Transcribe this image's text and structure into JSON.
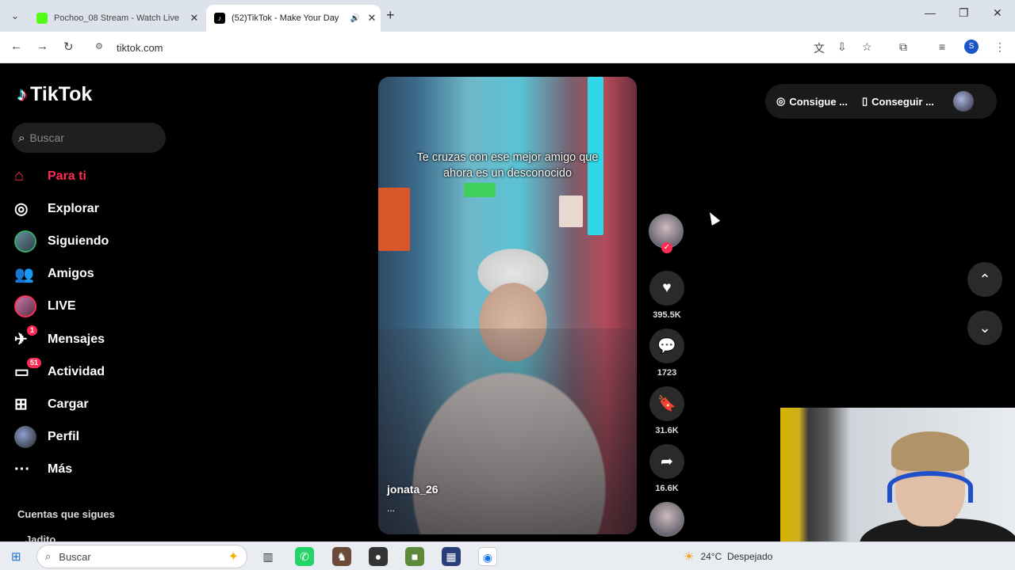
{
  "browser": {
    "tabs": [
      {
        "title": "Pochoo_08 Stream - Watch Live",
        "favicon_color": "#53fc18",
        "active": false
      },
      {
        "title": "(52)TikTok - Make Your Day",
        "favicon_color": "#000000",
        "active": true
      }
    ],
    "url": "tiktok.com",
    "profile_initial": "S"
  },
  "sidebar": {
    "logo": "TikTok",
    "search_placeholder": "Buscar",
    "items": [
      {
        "label": "Para ti",
        "icon": "home-icon",
        "active": true
      },
      {
        "label": "Explorar",
        "icon": "compass-icon"
      },
      {
        "label": "Siguiendo",
        "icon": "following-avatar-icon"
      },
      {
        "label": "Amigos",
        "icon": "friends-icon"
      },
      {
        "label": "LIVE",
        "icon": "live-avatar-icon"
      },
      {
        "label": "Mensajes",
        "icon": "messages-icon",
        "badge": "1"
      },
      {
        "label": "Actividad",
        "icon": "activity-icon",
        "badge": "51"
      },
      {
        "label": "Cargar",
        "icon": "upload-icon"
      },
      {
        "label": "Perfil",
        "icon": "profile-avatar-icon"
      },
      {
        "label": "Más",
        "icon": "more-icon"
      }
    ],
    "following_title": "Cuentas que sigues",
    "following_first": "Jadito"
  },
  "video": {
    "caption_line1": "Te cruzas con ese mejor amigo que",
    "caption_line2": "ahora es un desconocido",
    "username": "jonata_26",
    "description": "..."
  },
  "actions": {
    "likes": "395.5K",
    "comments": "1723",
    "saves": "31.6K",
    "shares": "16.6K"
  },
  "header": {
    "coins_label": "Consigue ...",
    "app_label": "Conseguir ..."
  },
  "taskbar": {
    "search_placeholder": "Buscar",
    "temperature": "24°C",
    "weather": "Despejado"
  }
}
